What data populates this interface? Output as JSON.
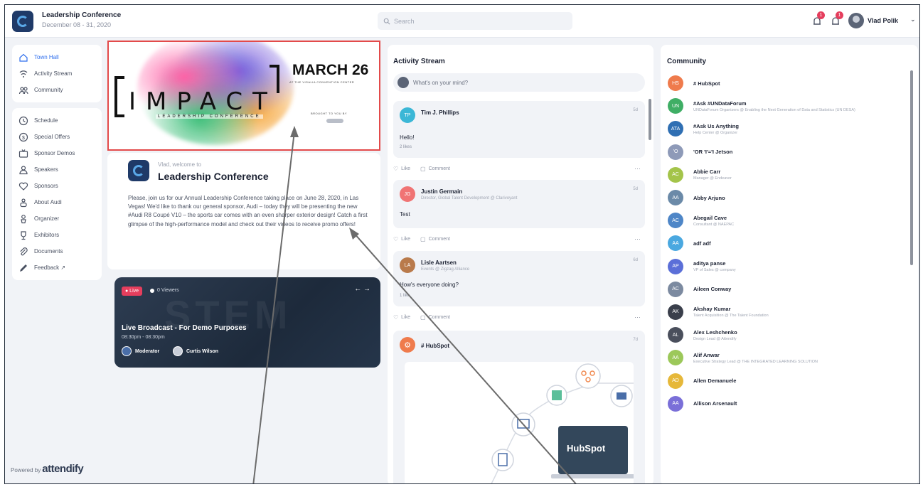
{
  "header": {
    "event_name": "Leadership Conference",
    "event_dates": "December 08 - 31, 2020",
    "search_placeholder": "Search",
    "notifications_badge": "1",
    "alerts_badge": "1",
    "user_name": "Vlad Polik",
    "user_chevron": "⌄"
  },
  "sidebar": {
    "groups": [
      [
        {
          "label": "Town Hall",
          "icon": "home-icon",
          "active": true
        },
        {
          "label": "Activity Stream",
          "icon": "wifi-icon"
        },
        {
          "label": "Community",
          "icon": "people-icon"
        }
      ],
      [
        {
          "label": "Schedule",
          "icon": "clock-icon"
        },
        {
          "label": "Special Offers",
          "icon": "dollar-icon"
        },
        {
          "label": "Sponsor Demos",
          "icon": "tv-icon"
        },
        {
          "label": "Speakers",
          "icon": "person-icon"
        },
        {
          "label": "Sponsors",
          "icon": "heart-icon"
        },
        {
          "label": "About Audi",
          "icon": "group-icon"
        },
        {
          "label": "Organizer",
          "icon": "organizer-icon"
        },
        {
          "label": "Exhibitors",
          "icon": "trophy-icon"
        },
        {
          "label": "Documents",
          "icon": "paperclip-icon"
        },
        {
          "label": "Feedback ↗",
          "icon": "pen-icon"
        }
      ]
    ],
    "powered_by": "Powered by",
    "brand": "attendify"
  },
  "banner": {
    "word": "IMPACT",
    "subtitle": "LEADERSHIP CONFERENCE",
    "date": "MARCH 26",
    "venue": "AT THE VISALIA CONVENTION CENTER",
    "presented": "BROUGHT TO YOU BY"
  },
  "welcome": {
    "greeting": "Vlad, welcome to",
    "title": "Leadership Conference",
    "body": "Please, join us for our Annual Leadership Conference taking place on June 28, 2020, in Las Vegas! We'd like to thank our general sponsor, Audi – today they will be presenting the new #Audi R8 Coupé V10 – the sports car comes with an even sharper exterior design! Catch a first glimpse of the high-performance model and check out their videos to receive promo offers!"
  },
  "live": {
    "badge": "● Live",
    "viewers": "0 Viewers",
    "nav": "←  →",
    "title": "Live Broadcast - For Demo Purposes",
    "time": "08:30pm - 08:30pm",
    "hosts": [
      "Moderator",
      "Curtis Wilson"
    ]
  },
  "activity": {
    "title": "Activity Stream",
    "composer_placeholder": "What's on your mind?",
    "like_label": "Like",
    "comment_label": "Comment",
    "more_label": "···",
    "posts": [
      {
        "initials": "TP",
        "name": "Tim J. Phillips",
        "subtitle": "",
        "time": "5d",
        "text": "Hello!",
        "meta": "2 likes",
        "color": "#3bb7d6"
      },
      {
        "initials": "JG",
        "name": "Justin Germain",
        "subtitle": "Director, Global Talent Development @ Clarivoyant",
        "time": "5d",
        "text": "Test",
        "meta": "",
        "color": "#f07474"
      },
      {
        "initials": "LA",
        "name": "Lisle Aartsen",
        "subtitle": "Events @ Zigzag Alliance",
        "time": "6d",
        "text": "How's everyone doing?",
        "meta": "1 like",
        "color": "#b97a4b"
      },
      {
        "initials": "HS",
        "name": "# HubSpot",
        "subtitle": "",
        "time": "7d",
        "text": "",
        "meta": "",
        "color": "#ef7b4c"
      }
    ],
    "hubspot_logo": "HubSpot"
  },
  "community": {
    "title": "Community",
    "members": [
      {
        "initials": "HS",
        "name": "# HubSpot",
        "subtitle": "",
        "color": "#ef7b4c"
      },
      {
        "initials": "UN",
        "name": "#Ask #UNDataForum",
        "subtitle": "UNDataForum Organizers @ Enabling the Next Generation of Data and Statistics (UN DESA)",
        "color": "#3fae65"
      },
      {
        "initials": "ATA",
        "name": "#Ask Us Anything",
        "subtitle": "Help Center @ Organizer",
        "color": "#2f6fb3"
      },
      {
        "initials": "'O",
        "name": "'OR 'I'='I Jetson",
        "subtitle": "",
        "color": "#8e9ab8"
      },
      {
        "initials": "AC",
        "name": "Abbie Carr",
        "subtitle": "Manager @ Endeavor",
        "color": "#a4c44a"
      },
      {
        "initials": "AA",
        "name": "Abby Arjuno",
        "subtitle": "",
        "color": "#6b8aa8"
      },
      {
        "initials": "AC",
        "name": "Abegail Cave",
        "subtitle": "Consultant @ NAEPAC",
        "color": "#4e86c7"
      },
      {
        "initials": "AA",
        "name": "adf adf",
        "subtitle": "",
        "color": "#4aa8e0"
      },
      {
        "initials": "AP",
        "name": "aditya panse",
        "subtitle": "VP of Sales @ company",
        "color": "#5b6fd8"
      },
      {
        "initials": "AC",
        "name": "Aileen Conway",
        "subtitle": "",
        "color": "#7c8aa0"
      },
      {
        "initials": "AK",
        "name": "Akshay Kumar",
        "subtitle": "Talent Acquisition @ The Talent Foundation",
        "color": "#3a3f4b"
      },
      {
        "initials": "AL",
        "name": "Alex Leshchenko",
        "subtitle": "Design Lead @ Attendify",
        "color": "#4a4f5c"
      },
      {
        "initials": "AA",
        "name": "Alif Anwar",
        "subtitle": "Executive Strategy Lead @ THE INTEGRATED LEARNING SOLUTION",
        "color": "#9cc85a"
      },
      {
        "initials": "AD",
        "name": "Allen Demanuele",
        "subtitle": "",
        "color": "#e6b83a"
      },
      {
        "initials": "AA",
        "name": "Allison Arsenault",
        "subtitle": "",
        "color": "#7a6fd8"
      }
    ]
  }
}
